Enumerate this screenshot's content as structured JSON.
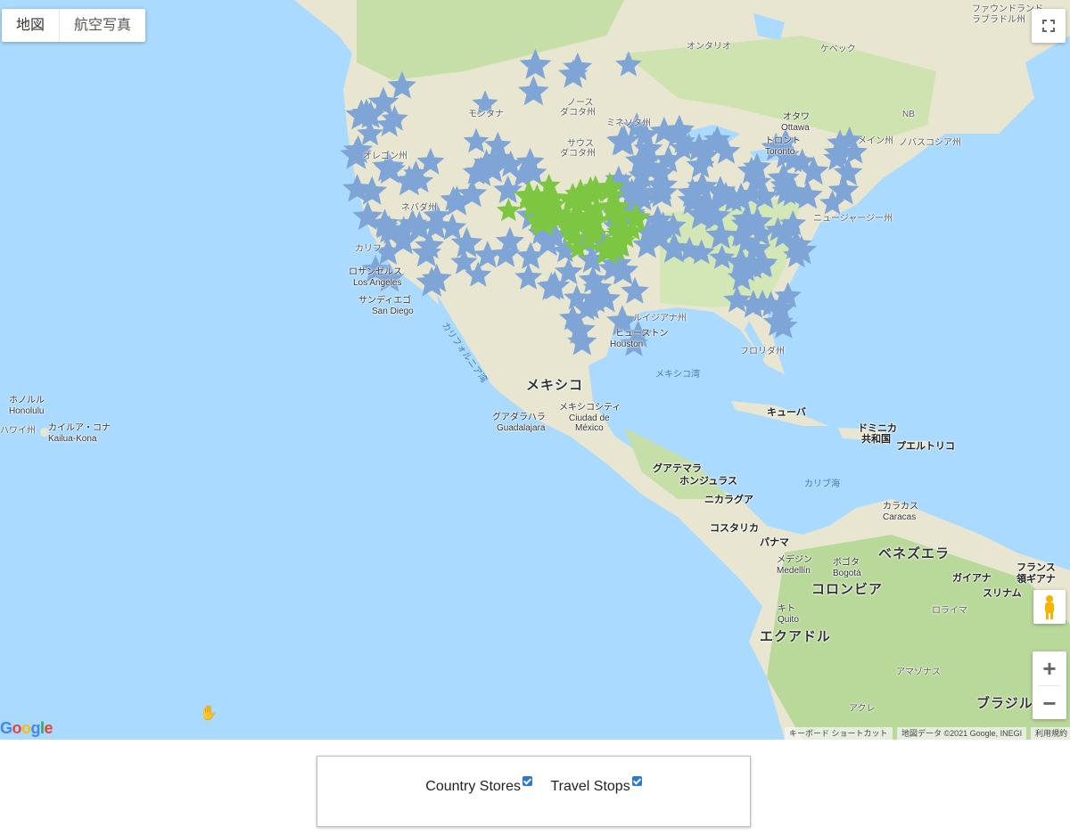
{
  "map_type": {
    "map_label": "地図",
    "satellite_label": "航空写真"
  },
  "labels": {
    "mexico": "メキシコ",
    "mexico_city_ja": "メキシコシティ",
    "mexico_city_es": "Ciudad de",
    "mexico_city_es2": "México",
    "guadalajara_ja": "グアダラハラ",
    "guadalajara": "Guadalajara",
    "los_angeles_ja": "ロサンゼルス",
    "los_angeles": "Los Angeles",
    "san_diego_ja": "サンディエゴ",
    "san_diego": "San Diego",
    "houston_ja": "ヒューストン",
    "houston": "Houston",
    "toronto_ja": "トロント",
    "toronto": "Toronto",
    "ottawa_ja": "オタワ",
    "ottawa": "Ottawa",
    "ontario": "オンタリオ",
    "quebec": "ケベック",
    "gulf": "メキシコ湾",
    "caribbean": "カリブ海",
    "cuba": "キューバ",
    "dominican": "ドミニカ",
    "dominican2": "共和国",
    "puerto_rico": "プエルトリコ",
    "guatemala": "グアテマラ",
    "honduras": "ホンジュラス",
    "nicaragua": "ニカラグア",
    "costa_rica": "コスタリカ",
    "panama": "パナマ",
    "colombia": "コロンビア",
    "venezuela": "ベネズエラ",
    "guyana": "ガイアナ",
    "suriname": "スリナム",
    "french_guiana": "フランス",
    "french_guiana2": "領ギアナ",
    "ecuador": "エクアドル",
    "brazil": "ブラジル",
    "caracas_ja": "カラカス",
    "caracas": "Caracas",
    "bogota_ja": "ボゴタ",
    "bogota": "Bogotá",
    "medellin_ja": "メデジン",
    "medellin": "Medellín",
    "quito_ja": "キト",
    "quito": "Quito",
    "honolulu_ja": "ホノルル",
    "honolulu": "Honolulu",
    "kailua_ja": "カイルア・コナ",
    "kailua": "Kailua-Kona",
    "hawaii": "ハワイ州",
    "baja": "カリフォルニア湾",
    "montana": "モンタナ",
    "north_dakota": "ノース",
    "north_dakota2": "ダコタ州",
    "south_dakota": "サウス",
    "south_dakota2": "ダコタ州",
    "oregon": "オレゴン州",
    "nevada": "ネバダ州",
    "california": "カリフ",
    "florida": "フロリダ州",
    "louisiana": "ルイジアナ州",
    "nb": "NB",
    "ns": "ノバスコシア州",
    "maine": "メイン州",
    "newfoundland": "ファウンドランド",
    "labrador": "ラブラドル州",
    "amazonas": "アマゾナス",
    "acre": "アクレ",
    "roraima": "ロライマ",
    "minnesota": "ミネソタ州",
    "new_jersey": "ニュージャージー州"
  },
  "controls": {
    "zoom_in": "+",
    "zoom_out": "−"
  },
  "google_logo": "Google",
  "attribution": {
    "keyboard": "キーボード ショートカット",
    "data": "地図データ ©2021 Google, INEGI",
    "terms": "利用規約"
  },
  "legend": {
    "country_stores": "Country Stores",
    "travel_stops": "Travel Stops",
    "country_stores_checked": true,
    "travel_stops_checked": true
  },
  "colors": {
    "ocean": "#aadaff",
    "land": "#e8e6d0",
    "vegetation": "#c6dfa9",
    "travel_stop_marker": "#7ea5d6",
    "country_store_marker": "#7cc642"
  }
}
